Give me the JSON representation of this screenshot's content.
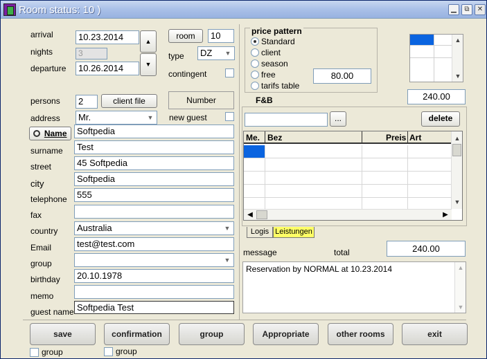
{
  "window": {
    "title": "Room status:  10 )",
    "minimize": "▁",
    "maximize": "⧉",
    "close": "✕"
  },
  "left": {
    "arrival_label": "arrival",
    "arrival_value": "10.23.2014",
    "nights_label": "nights",
    "nights_value": "3",
    "departure_label": "departure",
    "departure_value": "10.26.2014",
    "persons_label": "persons",
    "persons_value": "2",
    "client_file_btn": "client file",
    "address_label": "address",
    "address_value": "Mr.",
    "name_btn": "Name",
    "name_value": "Softpedia",
    "surname_label": "surname",
    "surname_value": "Test",
    "street_label": "street",
    "street_value": "45 Softpedia",
    "city_label": "city",
    "city_value": "Softpedia",
    "telephone_label": "telephone",
    "telephone_value": "555",
    "fax_label": "fax",
    "fax_value": "",
    "country_label": "country",
    "country_value": "Australia",
    "email_label": "Email",
    "email_value": "test@test.com",
    "group_label": "group",
    "group_value": "",
    "birthday_label": "birthday",
    "birthday_value": "20.10.1978",
    "memo_label": "memo",
    "memo_value": "",
    "guestname_label": "guest name",
    "guestname_value": "Softpedia Test"
  },
  "middle": {
    "room_btn": "room",
    "room_value": "10",
    "type_label": "type",
    "type_value": "DZ",
    "contingent_label": "contingent",
    "number_label": "Number",
    "new_guest_label": "new guest"
  },
  "price": {
    "title": "price pattern",
    "options": [
      "Standard",
      "client",
      "season",
      "free",
      "tarifs table"
    ],
    "selected": "Standard",
    "amount": "80.00"
  },
  "right": {
    "fb_label": "F&B",
    "fb_value": "240.00",
    "search_value": "",
    "dots_btn": "...",
    "delete_btn": "delete",
    "columns": [
      "Me.",
      "Bez",
      "Preis",
      "Art"
    ],
    "tabs": [
      "Logis",
      "Leistungen"
    ],
    "message_label": "message",
    "total_label": "total",
    "total_value": "240.00",
    "message_text": "Reservation by NORMAL at 10.23.2014"
  },
  "buttons": {
    "save": "save",
    "confirmation": "confirmation",
    "group": "group",
    "appropriate": "Appropriate",
    "other_rooms": "other rooms",
    "exit": "exit"
  },
  "footer": {
    "group1": "group",
    "group2": "group"
  },
  "colors": {
    "selection": "#0a64e0",
    "tab_active": "#ffff66",
    "title_gradient": "#a9c0e8"
  }
}
